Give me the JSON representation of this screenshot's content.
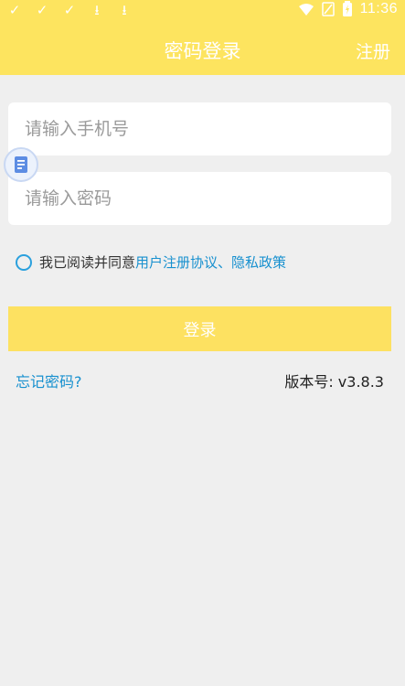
{
  "colors": {
    "brand_yellow": "#fde45f",
    "link_blue": "#1790cf",
    "background": "#efefef"
  },
  "status_bar": {
    "icons": [
      "check-icon",
      "check-icon",
      "check-icon",
      "download-icon",
      "download-icon",
      "wifi-icon",
      "sim-icon",
      "battery-icon"
    ],
    "time": "11:36"
  },
  "header": {
    "title": "密码登录",
    "register_label": "注册"
  },
  "form": {
    "phone_placeholder": "请输入手机号",
    "password_placeholder": "请输入密码",
    "agreement_prefix": "我已阅读并同意",
    "agreement_link": "用户注册协议、隐私政策",
    "login_label": "登录",
    "forgot_label": "忘记密码?",
    "version_label": "版本号: v3.8.3"
  }
}
